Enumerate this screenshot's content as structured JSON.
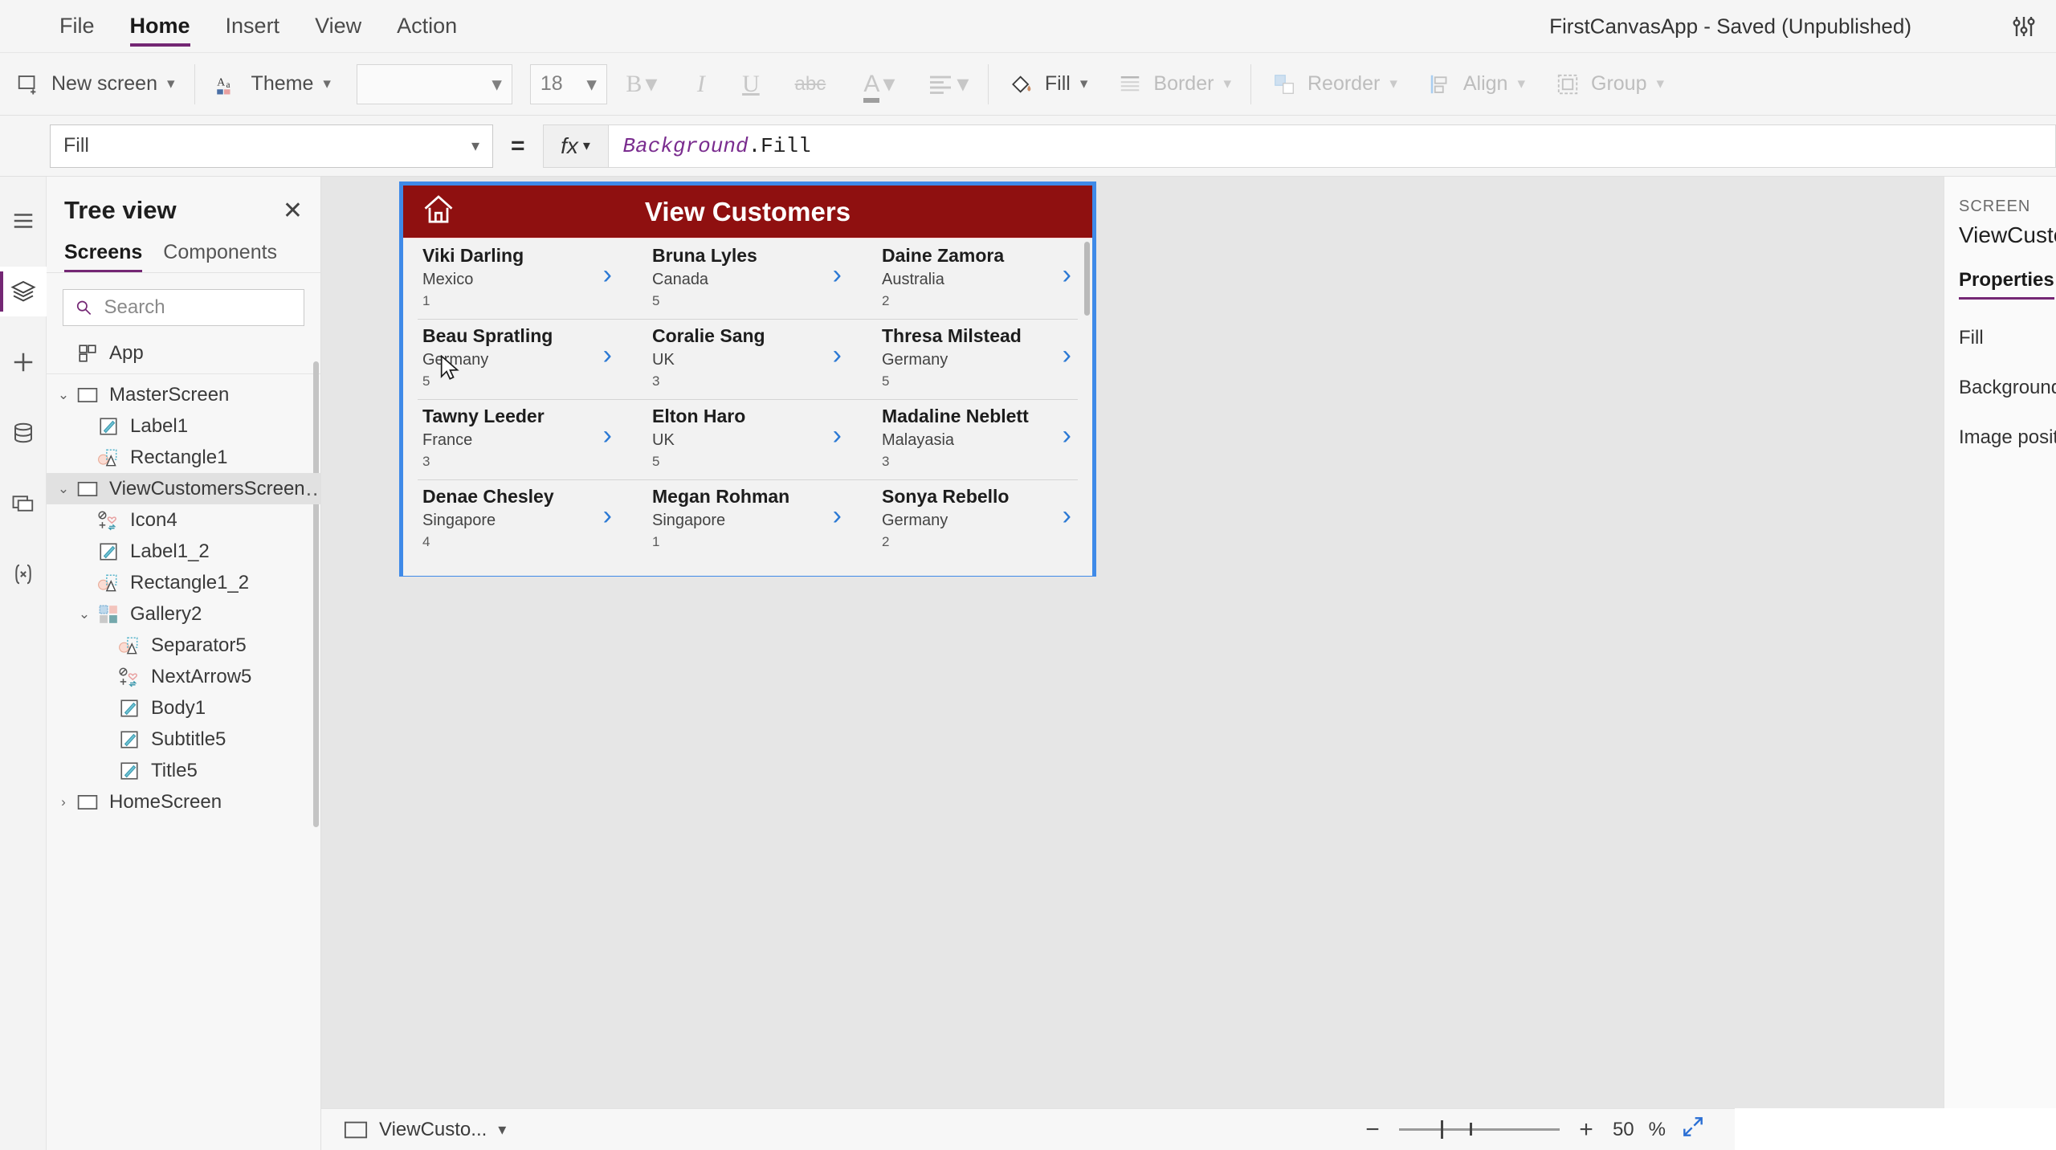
{
  "menubar": {
    "items": [
      {
        "label": "File",
        "active": false
      },
      {
        "label": "Home",
        "active": true
      },
      {
        "label": "Insert",
        "active": false
      },
      {
        "label": "View",
        "active": false
      },
      {
        "label": "Action",
        "active": false
      }
    ],
    "app_status": "FirstCanvasApp - Saved (Unpublished)"
  },
  "ribbon": {
    "new_screen": "New screen",
    "theme": "Theme",
    "font_name": "",
    "font_size": "18",
    "bold": "B",
    "italic": "I",
    "underline": "U",
    "strikethrough": "abc",
    "font_color": "A",
    "align": "align-left",
    "fill": "Fill",
    "border": "Border",
    "reorder": "Reorder",
    "align_label": "Align",
    "group": "Group"
  },
  "formulabar": {
    "property": "Fill",
    "equals": "=",
    "fx": "fx",
    "formula_ident": "Background",
    "formula_dot": ".",
    "formula_prop": "Fill"
  },
  "treeview": {
    "title": "Tree view",
    "close": "✕",
    "tabs": [
      {
        "label": "Screens",
        "active": true
      },
      {
        "label": "Components",
        "active": false
      }
    ],
    "search_placeholder": "Search",
    "search_value": "",
    "items": [
      {
        "label": "App",
        "indent": 0,
        "icon": "app-icon",
        "twisty": "",
        "selected": false,
        "dots": false,
        "divider_after": true
      },
      {
        "label": "MasterScreen",
        "indent": 0,
        "icon": "screen-icon",
        "twisty": "⌄",
        "selected": false,
        "dots": false
      },
      {
        "label": "Label1",
        "indent": 1,
        "icon": "label-icon",
        "twisty": "",
        "selected": false,
        "dots": false
      },
      {
        "label": "Rectangle1",
        "indent": 1,
        "icon": "shape-icon",
        "twisty": "",
        "selected": false,
        "dots": false
      },
      {
        "label": "ViewCustomersScreen",
        "indent": 0,
        "icon": "screen-icon",
        "twisty": "⌄",
        "selected": true,
        "dots": true
      },
      {
        "label": "Icon4",
        "indent": 1,
        "icon": "icon-icon",
        "twisty": "",
        "selected": false,
        "dots": false
      },
      {
        "label": "Label1_2",
        "indent": 1,
        "icon": "label-icon",
        "twisty": "",
        "selected": false,
        "dots": false
      },
      {
        "label": "Rectangle1_2",
        "indent": 1,
        "icon": "shape-icon",
        "twisty": "",
        "selected": false,
        "dots": false
      },
      {
        "label": "Gallery2",
        "indent": 1,
        "icon": "gallery-icon",
        "twisty": "⌄",
        "selected": false,
        "dots": false
      },
      {
        "label": "Separator5",
        "indent": 2,
        "icon": "shape-icon",
        "twisty": "",
        "selected": false,
        "dots": false
      },
      {
        "label": "NextArrow5",
        "indent": 2,
        "icon": "icon-icon",
        "twisty": "",
        "selected": false,
        "dots": false
      },
      {
        "label": "Body1",
        "indent": 2,
        "icon": "label-icon",
        "twisty": "",
        "selected": false,
        "dots": false
      },
      {
        "label": "Subtitle5",
        "indent": 2,
        "icon": "label-icon",
        "twisty": "",
        "selected": false,
        "dots": false
      },
      {
        "label": "Title5",
        "indent": 2,
        "icon": "label-icon",
        "twisty": "",
        "selected": false,
        "dots": false
      },
      {
        "label": "HomeScreen",
        "indent": 0,
        "icon": "screen-icon",
        "twisty": "›",
        "selected": false,
        "dots": false
      }
    ]
  },
  "canvas": {
    "screen_title": "View Customers",
    "header_color": "#8f1010",
    "selection_color": "#3f8ae8",
    "home_icon": "home-icon",
    "customers": [
      {
        "name": "Viki  Darling",
        "country": "Mexico",
        "num": "1"
      },
      {
        "name": "Bruna  Lyles",
        "country": "Canada",
        "num": "5"
      },
      {
        "name": "Daine  Zamora",
        "country": "Australia",
        "num": "2"
      },
      {
        "name": "Beau  Spratling",
        "country": "Germany",
        "num": "5"
      },
      {
        "name": "Coralie  Sang",
        "country": "UK",
        "num": "3"
      },
      {
        "name": "Thresa  Milstead",
        "country": "Germany",
        "num": "5"
      },
      {
        "name": "Tawny  Leeder",
        "country": "France",
        "num": "3"
      },
      {
        "name": "Elton  Haro",
        "country": "UK",
        "num": "5"
      },
      {
        "name": "Madaline  Neblett",
        "country": "Malayasia",
        "num": "3"
      },
      {
        "name": "Denae  Chesley",
        "country": "Singapore",
        "num": "4"
      },
      {
        "name": "Megan  Rohman",
        "country": "Singapore",
        "num": "1"
      },
      {
        "name": "Sonya  Rebello",
        "country": "Germany",
        "num": "2"
      }
    ]
  },
  "properties": {
    "kicker": "SCREEN",
    "name": "ViewCusto",
    "tab": "Properties",
    "fields": [
      "Fill",
      "Background",
      "Image positi"
    ]
  },
  "statusbar": {
    "screen_name": "ViewCusto...",
    "zoom_minus": "−",
    "zoom_plus": "+",
    "zoom_value": "50",
    "zoom_unit": "%"
  }
}
